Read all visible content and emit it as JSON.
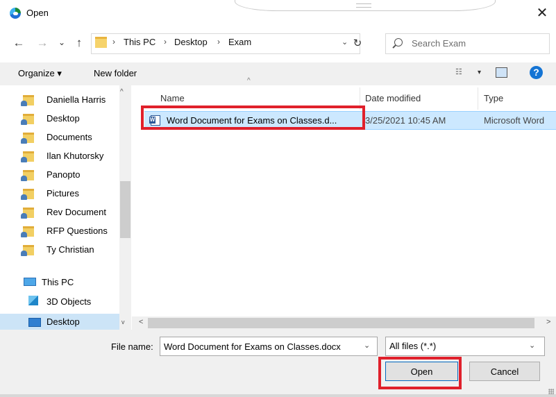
{
  "window": {
    "title": "Open",
    "close_glyph": "✕",
    "app_icon": "edge-icon"
  },
  "nav": {
    "back": "←",
    "forward": "→",
    "recent": "⌄",
    "up": "↑"
  },
  "address": {
    "crumbs": [
      "This PC",
      "Desktop",
      "Exam"
    ],
    "separator": "›",
    "leading_separator": "›",
    "chevron": "⌄",
    "refresh": "↻"
  },
  "search": {
    "placeholder": "Search Exam"
  },
  "toolbar": {
    "organize": "Organize ▾",
    "new_folder": "New folder",
    "view_glyph": "☷",
    "view_chevron": "▾",
    "help": "?"
  },
  "sidebar": {
    "items": [
      {
        "label": "Daniella Harris"
      },
      {
        "label": "Desktop"
      },
      {
        "label": "Documents"
      },
      {
        "label": "Ilan Khutorsky"
      },
      {
        "label": "Panopto"
      },
      {
        "label": "Pictures"
      },
      {
        "label": "Rev Document"
      },
      {
        "label": "RFP Questions"
      },
      {
        "label": "Ty Christian"
      }
    ],
    "this_pc": "This PC",
    "objects_3d": "3D Objects",
    "desktop": "Desktop",
    "scroll_up": "^",
    "scroll_down": "v"
  },
  "columns": {
    "name": "Name",
    "date": "Date modified",
    "type": "Type",
    "sort_indicator": "^"
  },
  "files": [
    {
      "name": "Word Document for Exams on Classes.d...",
      "date": "3/25/2021 10:45 AM",
      "type": "Microsoft Word"
    }
  ],
  "hscroll": {
    "left": "<",
    "right": ">"
  },
  "bottom": {
    "file_name_label": "File name:",
    "file_name_value": "Word Document for Exams on Classes.docx",
    "chevron": "⌄",
    "filter_value": "All files (*.*)",
    "open": "Open",
    "cancel": "Cancel"
  },
  "colors": {
    "highlight": "#e0202b",
    "selection": "#cce8ff",
    "accent": "#0067c0"
  }
}
